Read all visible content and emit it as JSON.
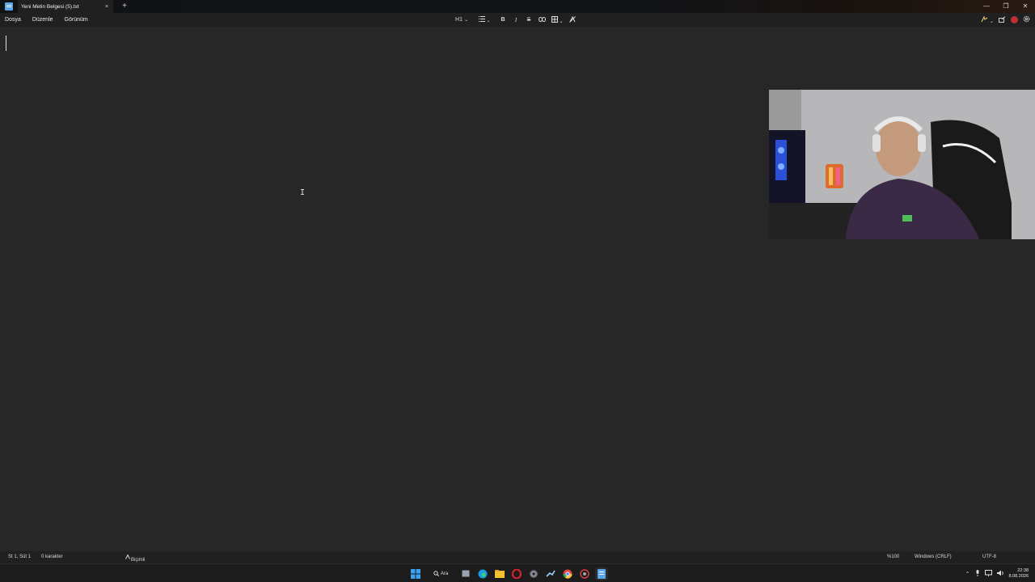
{
  "window": {
    "tab_title": "Yeni Metin Belgesi (5).txt",
    "tab_close": "×",
    "new_tab": "+",
    "minimize": "—",
    "maximize": "❐",
    "close": "✕"
  },
  "menu": {
    "file": "Dosya",
    "edit": "Düzenle",
    "view": "Görünüm"
  },
  "toolbar": {
    "heading": "H1",
    "heading_chevron": "⌄",
    "list_chevron": "⌄",
    "bold": "B",
    "italic": "I",
    "strike": "S",
    "table_chevron": "⌄"
  },
  "statusbar": {
    "position": "St 1, Süt 1",
    "char_count": "0 karakter",
    "format_mode": "Biçimli",
    "zoom": "%100",
    "line_ending": "Windows (CRLF)",
    "encoding": "UTF-8"
  },
  "taskbar": {
    "search_label": "Ara",
    "time": "22:38",
    "date": "8.08.2026"
  },
  "colors": {
    "editor_bg": "#272727",
    "chrome_bg": "#202020",
    "accent": "#5aa6e8"
  },
  "icons": {
    "app": "notepad-icon",
    "list": "list-icon",
    "link": "link-icon",
    "table": "table-icon",
    "clear_format": "clear-formatting-icon",
    "copilot": "copilot-icon",
    "share": "share-icon",
    "settings": "gear-icon"
  }
}
